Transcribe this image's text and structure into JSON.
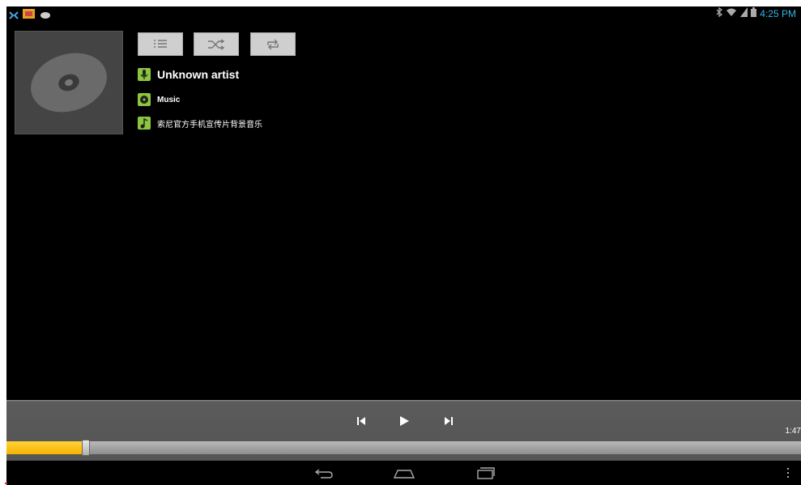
{
  "status_bar": {
    "left_icons": [
      "bug-notification-icon",
      "photo-notification-icon",
      "cloud-notification-icon"
    ],
    "right_icons": [
      "bluetooth-icon",
      "wifi-icon",
      "signal-icon",
      "battery-icon"
    ],
    "time": "4:25 PM"
  },
  "player": {
    "modes": [
      {
        "icon": "playlist-icon"
      },
      {
        "icon": "shuffle-icon"
      },
      {
        "icon": "repeat-icon"
      }
    ],
    "artist": "Unknown artist",
    "album": "Music",
    "track_title": "索尼官方手机宣传片背景音乐",
    "elapsed_time": "1:47",
    "progress": 0.1
  },
  "controls": [
    "previous-icon",
    "play-icon",
    "next-icon"
  ],
  "nav": [
    "back-icon",
    "home-icon",
    "recent-apps-icon",
    "menu-icon"
  ],
  "colors": {
    "accent_blue": "#33b5e5",
    "icon_green": "#8cc63f",
    "progress_yellow": "#f6b400",
    "panel_gray": "#555555"
  }
}
